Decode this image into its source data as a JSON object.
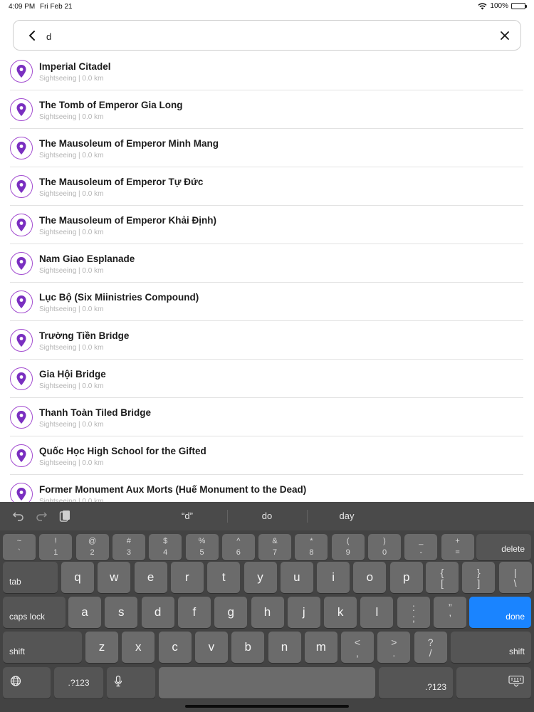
{
  "status_bar": {
    "time": "4:09 PM",
    "date": "Fri Feb 21",
    "battery": "100%"
  },
  "search": {
    "query": "d",
    "back_icon": "chevron-left-icon",
    "clear_icon": "close-icon"
  },
  "results": [
    {
      "title": "Imperial Citadel",
      "subtitle": "Sightseeing | 0.0 km"
    },
    {
      "title": "The Tomb of Emperor Gia Long",
      "subtitle": "Sightseeing | 0.0 km"
    },
    {
      "title": "The Mausoleum of Emperor Minh Mang",
      "subtitle": "Sightseeing | 0.0 km"
    },
    {
      "title": "The Mausoleum of Emperor Tự Đức",
      "subtitle": "Sightseeing | 0.0 km"
    },
    {
      "title": "The Mausoleum of Emperor Khải Định)",
      "subtitle": "Sightseeing | 0.0 km"
    },
    {
      "title": "Nam Giao Esplanade",
      "subtitle": "Sightseeing | 0.0 km"
    },
    {
      "title": "Lục Bộ (Six Miinistries Compound)",
      "subtitle": "Sightseeing | 0.0 km"
    },
    {
      "title": "Trường Tiền Bridge",
      "subtitle": "Sightseeing | 0.0 km"
    },
    {
      "title": "Gia Hội Bridge",
      "subtitle": "Sightseeing | 0.0 km"
    },
    {
      "title": "Thanh Toàn Tiled Bridge",
      "subtitle": "Sightseeing | 0.0 km"
    },
    {
      "title": "Quốc Học High School for the Gifted",
      "subtitle": "Sightseeing | 0.0 km"
    },
    {
      "title": "Former Monument Aux Morts (Huế Monument to the Dead)",
      "subtitle": "Sightseeing | 0.0 km"
    }
  ],
  "keyboard": {
    "suggestions": [
      "“d”",
      "do",
      "day"
    ],
    "row1": [
      {
        "top": "~",
        "bot": "`"
      },
      {
        "top": "!",
        "bot": "1"
      },
      {
        "top": "@",
        "bot": "2"
      },
      {
        "top": "#",
        "bot": "3"
      },
      {
        "top": "$",
        "bot": "4"
      },
      {
        "top": "%",
        "bot": "5"
      },
      {
        "top": "^",
        "bot": "6"
      },
      {
        "top": "&",
        "bot": "7"
      },
      {
        "top": "*",
        "bot": "8"
      },
      {
        "top": "(",
        "bot": "9"
      },
      {
        "top": ")",
        "bot": "0"
      },
      {
        "top": "_",
        "bot": "-"
      },
      {
        "top": "+",
        "bot": "="
      }
    ],
    "row2": [
      "q",
      "w",
      "e",
      "r",
      "t",
      "y",
      "u",
      "i",
      "o",
      "p"
    ],
    "row2_sym": [
      {
        "top": "{",
        "bot": "["
      },
      {
        "top": "}",
        "bot": "]"
      },
      {
        "top": "|",
        "bot": "\\"
      }
    ],
    "row3": [
      "a",
      "s",
      "d",
      "f",
      "g",
      "h",
      "j",
      "k",
      "l"
    ],
    "row3_sym": [
      {
        "top": ":",
        "bot": ";"
      },
      {
        "top": "”",
        "bot": "’"
      }
    ],
    "row4": [
      "z",
      "x",
      "c",
      "v",
      "b",
      "n",
      "m"
    ],
    "row4_sym": [
      {
        "top": "<",
        "bot": ","
      },
      {
        "top": ">",
        "bot": "."
      },
      {
        "top": "?",
        "bot": "/"
      }
    ],
    "labels": {
      "delete": "delete",
      "tab": "tab",
      "caps_lock": "caps lock",
      "done": "done",
      "shift": "shift",
      "numbers": ".?123"
    },
    "colors": {
      "accent": "#1a84ff",
      "pin": "#7a2fc0"
    }
  }
}
